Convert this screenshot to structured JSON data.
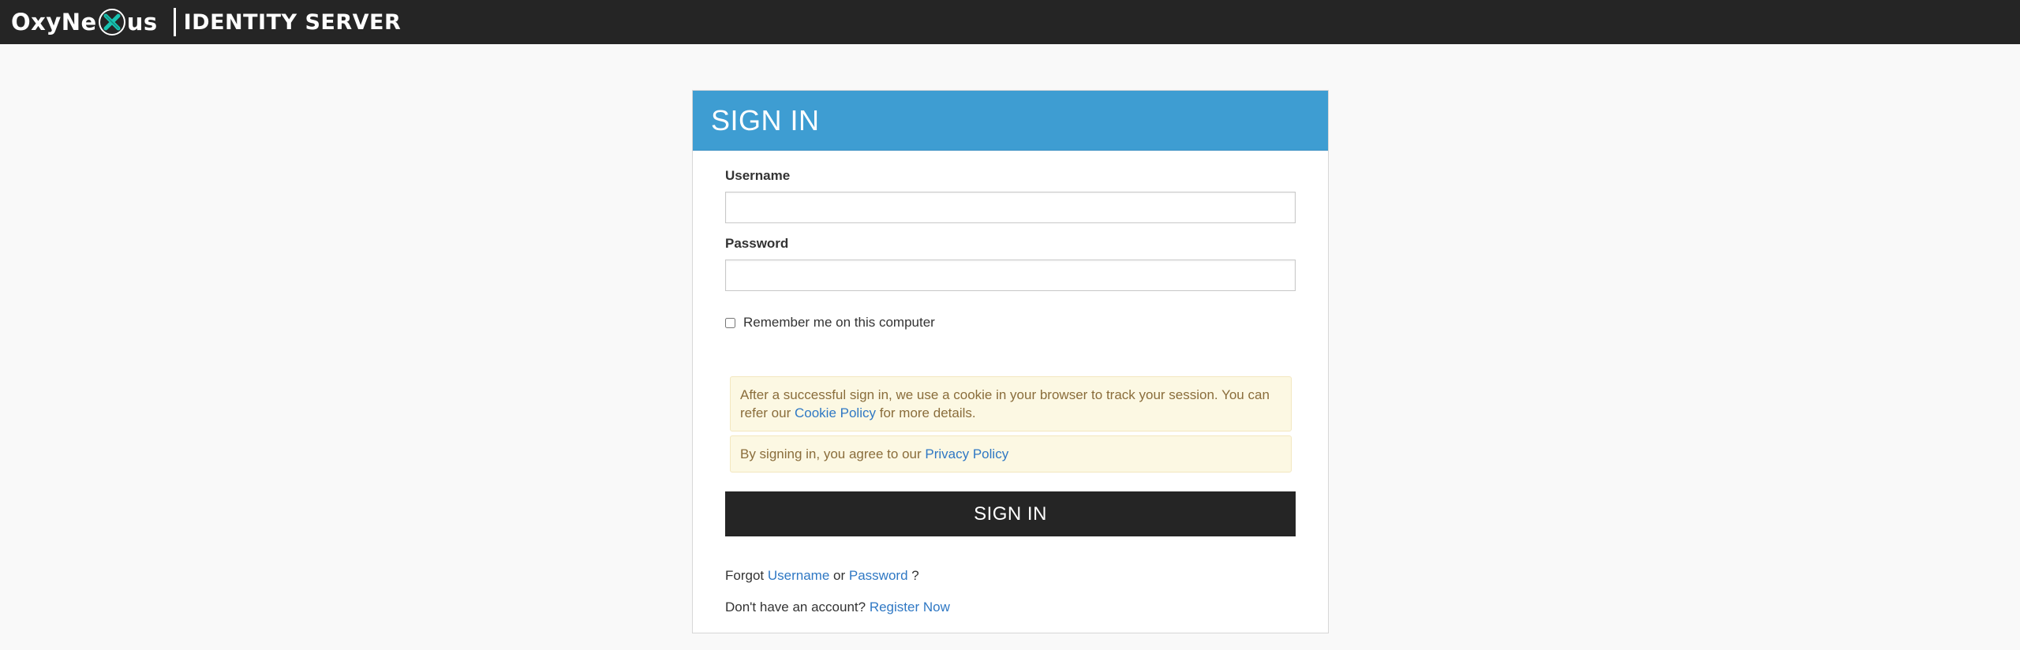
{
  "header": {
    "brand_prefix": "OxyNe",
    "brand_suffix": "us",
    "product": "IDENTITY SERVER",
    "bar_color": "#252525",
    "logo_icon": "oxynexus-x-logo-icon"
  },
  "panel": {
    "title": "SIGN IN",
    "head_color": "#3e9dd2"
  },
  "form": {
    "username_label": "Username",
    "username_value": "",
    "password_label": "Password",
    "password_value": "",
    "remember_label": "Remember me on this computer",
    "remember_checked": false
  },
  "notices": {
    "cookie_text_before": "After a successful sign in, we use a cookie in your browser to track your session. You can refer our",
    "cookie_link": "Cookie Policy",
    "cookie_text_after": "for more details.",
    "privacy_text_before": "By signing in, you agree to our",
    "privacy_link": "Privacy Policy"
  },
  "actions": {
    "sign_in_label": "SIGN IN",
    "button_color": "#252525"
  },
  "links": {
    "forgot_prefix": "Forgot",
    "forgot_username": "Username",
    "forgot_or": "or",
    "forgot_password": "Password",
    "forgot_suffix": "?",
    "register_prefix": "Don't have an account?",
    "register_link": "Register Now"
  }
}
